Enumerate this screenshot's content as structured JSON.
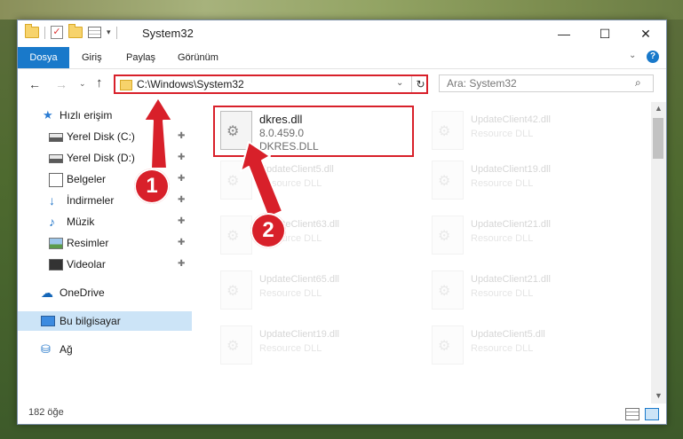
{
  "window": {
    "title": "System32"
  },
  "ribbon": {
    "tabs": [
      "Dosya",
      "Giriş",
      "Paylaş",
      "Görünüm"
    ],
    "help_label": "?"
  },
  "navigation": {
    "address_path": "C:\\Windows\\System32",
    "search_placeholder": "Ara: System32"
  },
  "sidebar": {
    "items": [
      {
        "label": "Hızlı erişim",
        "icon": "star-icon",
        "pinned": false
      },
      {
        "label": "Yerel Disk (C:)",
        "icon": "disk-icon",
        "pinned": true
      },
      {
        "label": "Yerel Disk (D:)",
        "icon": "disk-icon",
        "pinned": true
      },
      {
        "label": "Belgeler",
        "icon": "documents-icon",
        "pinned": true
      },
      {
        "label": "İndirmeler",
        "icon": "download-icon",
        "pinned": true
      },
      {
        "label": "Müzik",
        "icon": "music-icon",
        "pinned": true
      },
      {
        "label": "Resimler",
        "icon": "pictures-icon",
        "pinned": true
      },
      {
        "label": "Videolar",
        "icon": "videos-icon",
        "pinned": true
      },
      {
        "label": "OneDrive",
        "icon": "cloud-icon",
        "pinned": false
      },
      {
        "label": "Bu bilgisayar",
        "icon": "computer-icon",
        "pinned": false,
        "selected": true
      },
      {
        "label": "Ağ",
        "icon": "network-icon",
        "pinned": false
      }
    ]
  },
  "files": {
    "highlighted": {
      "name": "dkres.dll",
      "version": "8.0.459.0",
      "description": "DKRES.DLL"
    },
    "faded_left": [
      {
        "name": "UpdateClient5.dll",
        "description": "Resource DLL"
      },
      {
        "name": "UpdateClient63.dll",
        "description": "Resource DLL"
      },
      {
        "name": "UpdateClient65.dll",
        "description": "Resource DLL"
      },
      {
        "name": "UpdateClient19.dll",
        "description": "Resource DLL"
      }
    ],
    "faded_right": [
      {
        "name": "UpdateClient42.dll",
        "description": "Resource DLL"
      },
      {
        "name": "UpdateClient19.dll",
        "description": "Resource DLL"
      },
      {
        "name": "UpdateClient21.dll",
        "description": "Resource DLL"
      },
      {
        "name": "UpdateClient21.dll",
        "description": "Resource DLL"
      },
      {
        "name": "UpdateClient5.dll",
        "description": "Resource DLL"
      }
    ]
  },
  "status": {
    "item_count": "182 öğe"
  },
  "callouts": {
    "first": "1",
    "second": "2"
  },
  "colors": {
    "accent": "#1979ca",
    "highlight": "#d8202a",
    "selection": "#cce4f7"
  }
}
